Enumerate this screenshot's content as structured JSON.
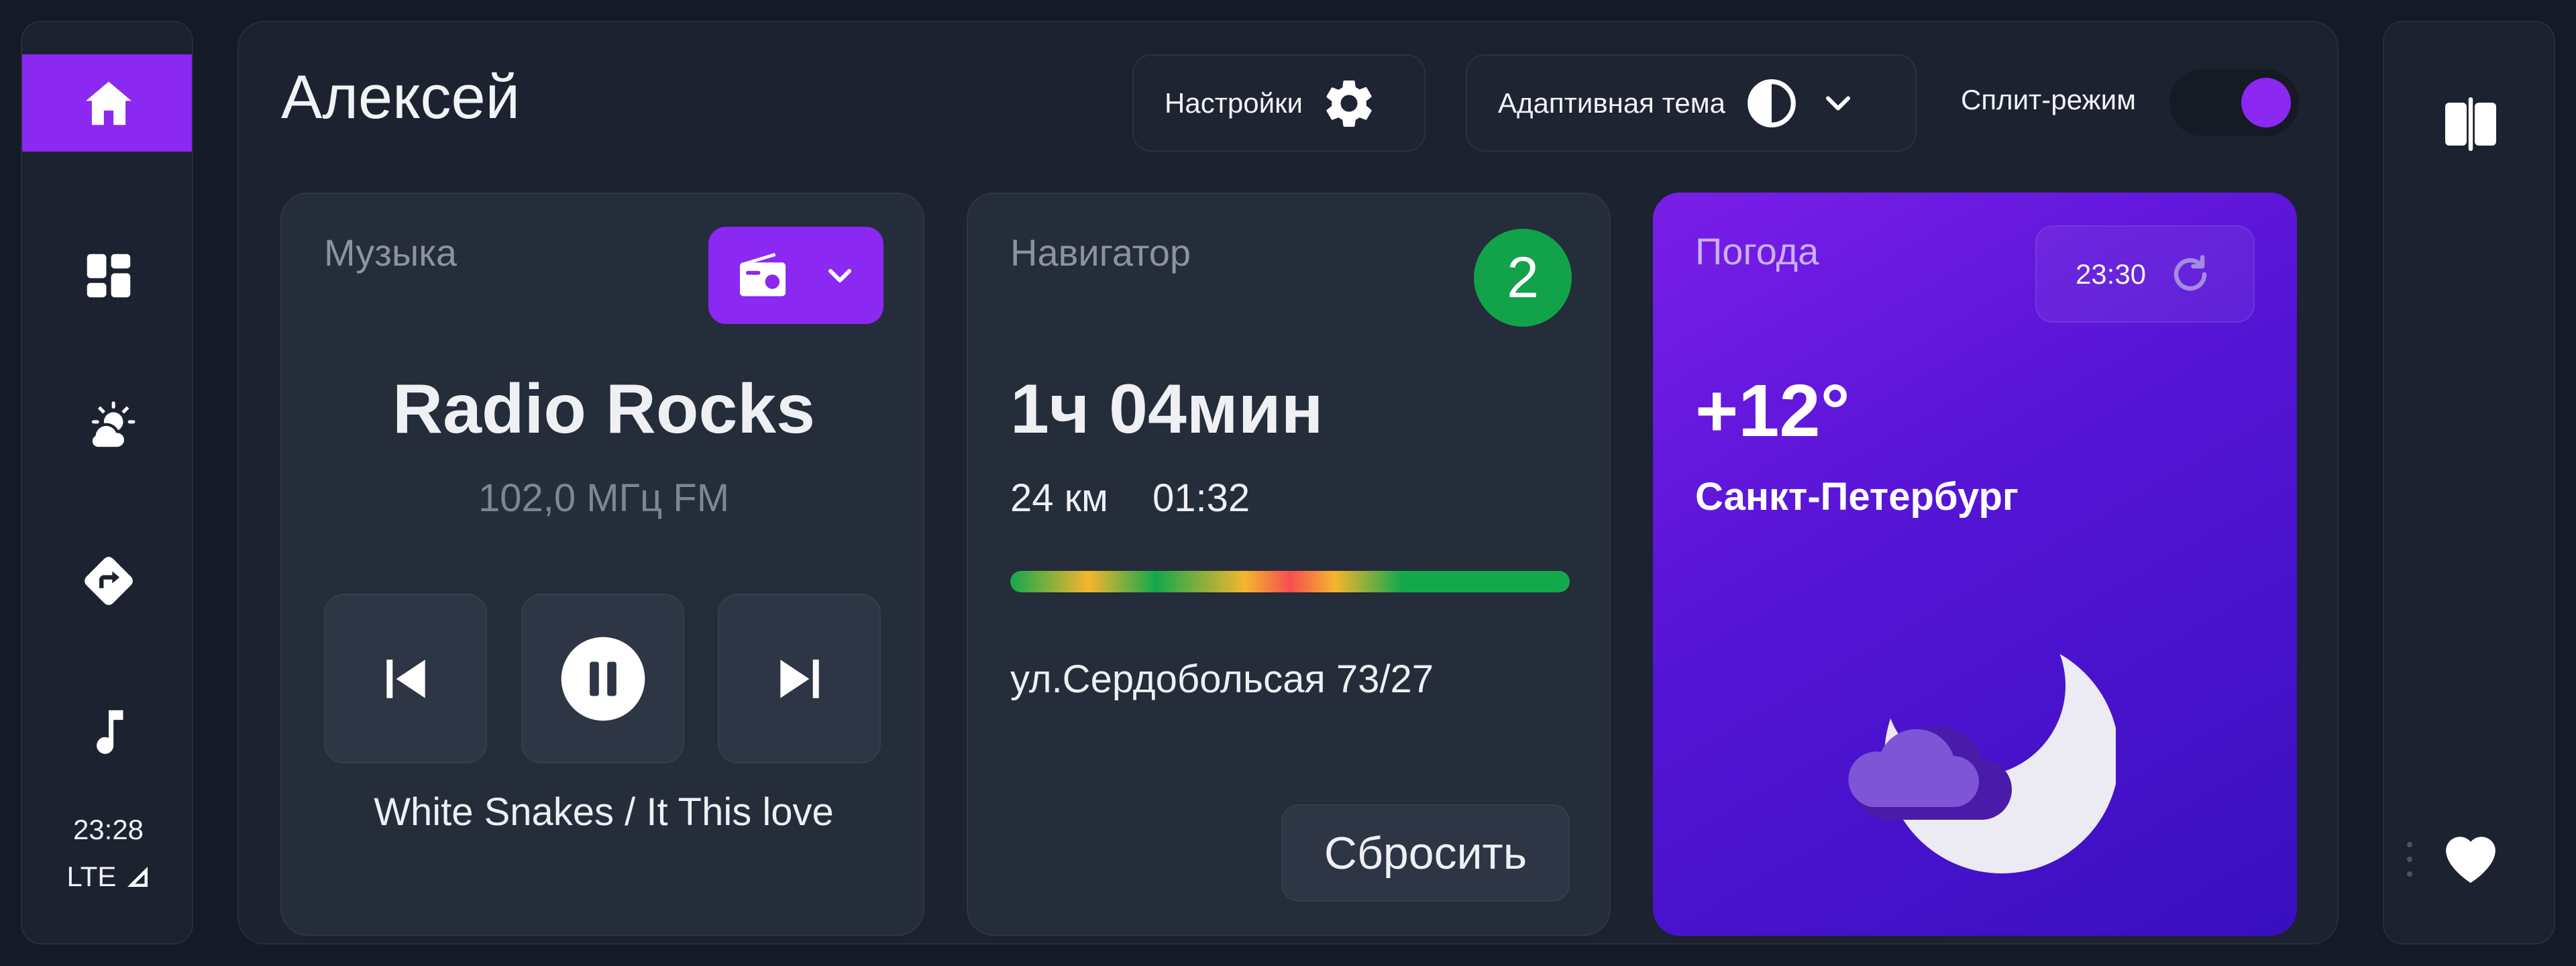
{
  "user": {
    "name": "Алексей"
  },
  "header": {
    "settings_label": "Настройки",
    "theme_label": "Адаптивная тема",
    "split_label": "Сплит-режим",
    "split_enabled": true
  },
  "sidebar": {
    "items": [
      {
        "icon": "home-icon",
        "active": true
      },
      {
        "icon": "dashboard-icon",
        "active": false
      },
      {
        "icon": "weather-icon",
        "active": false
      },
      {
        "icon": "navigation-icon",
        "active": false
      },
      {
        "icon": "music-note-icon",
        "active": false
      }
    ],
    "time": "23:28",
    "network": "LTE"
  },
  "music": {
    "title": "Музыка",
    "source_icon": "radio-icon",
    "station": "Radio Rocks",
    "frequency": "102,0 МГц FM",
    "track": "White Snakes / It This love",
    "state": "playing"
  },
  "navigator": {
    "title": "Навигатор",
    "badge": "2",
    "eta": "1ч 04мин",
    "distance": "24 км",
    "arrival": "01:32",
    "address": "ул.Сердобольсая 73/27",
    "reset_label": "Сбросить",
    "traffic_colors": [
      "#14a84c",
      "#f5b52e",
      "#f44f4f"
    ]
  },
  "weather": {
    "title": "Погода",
    "update_time": "23:30",
    "temperature": "+12°",
    "city": "Санкт-Петербург",
    "condition_icon": "moon-cloud-icon"
  },
  "colors": {
    "accent": "#8b28f2",
    "badge_green": "#12a24a",
    "card_bg": "#252c3a",
    "panel_bg": "#1c2230"
  }
}
